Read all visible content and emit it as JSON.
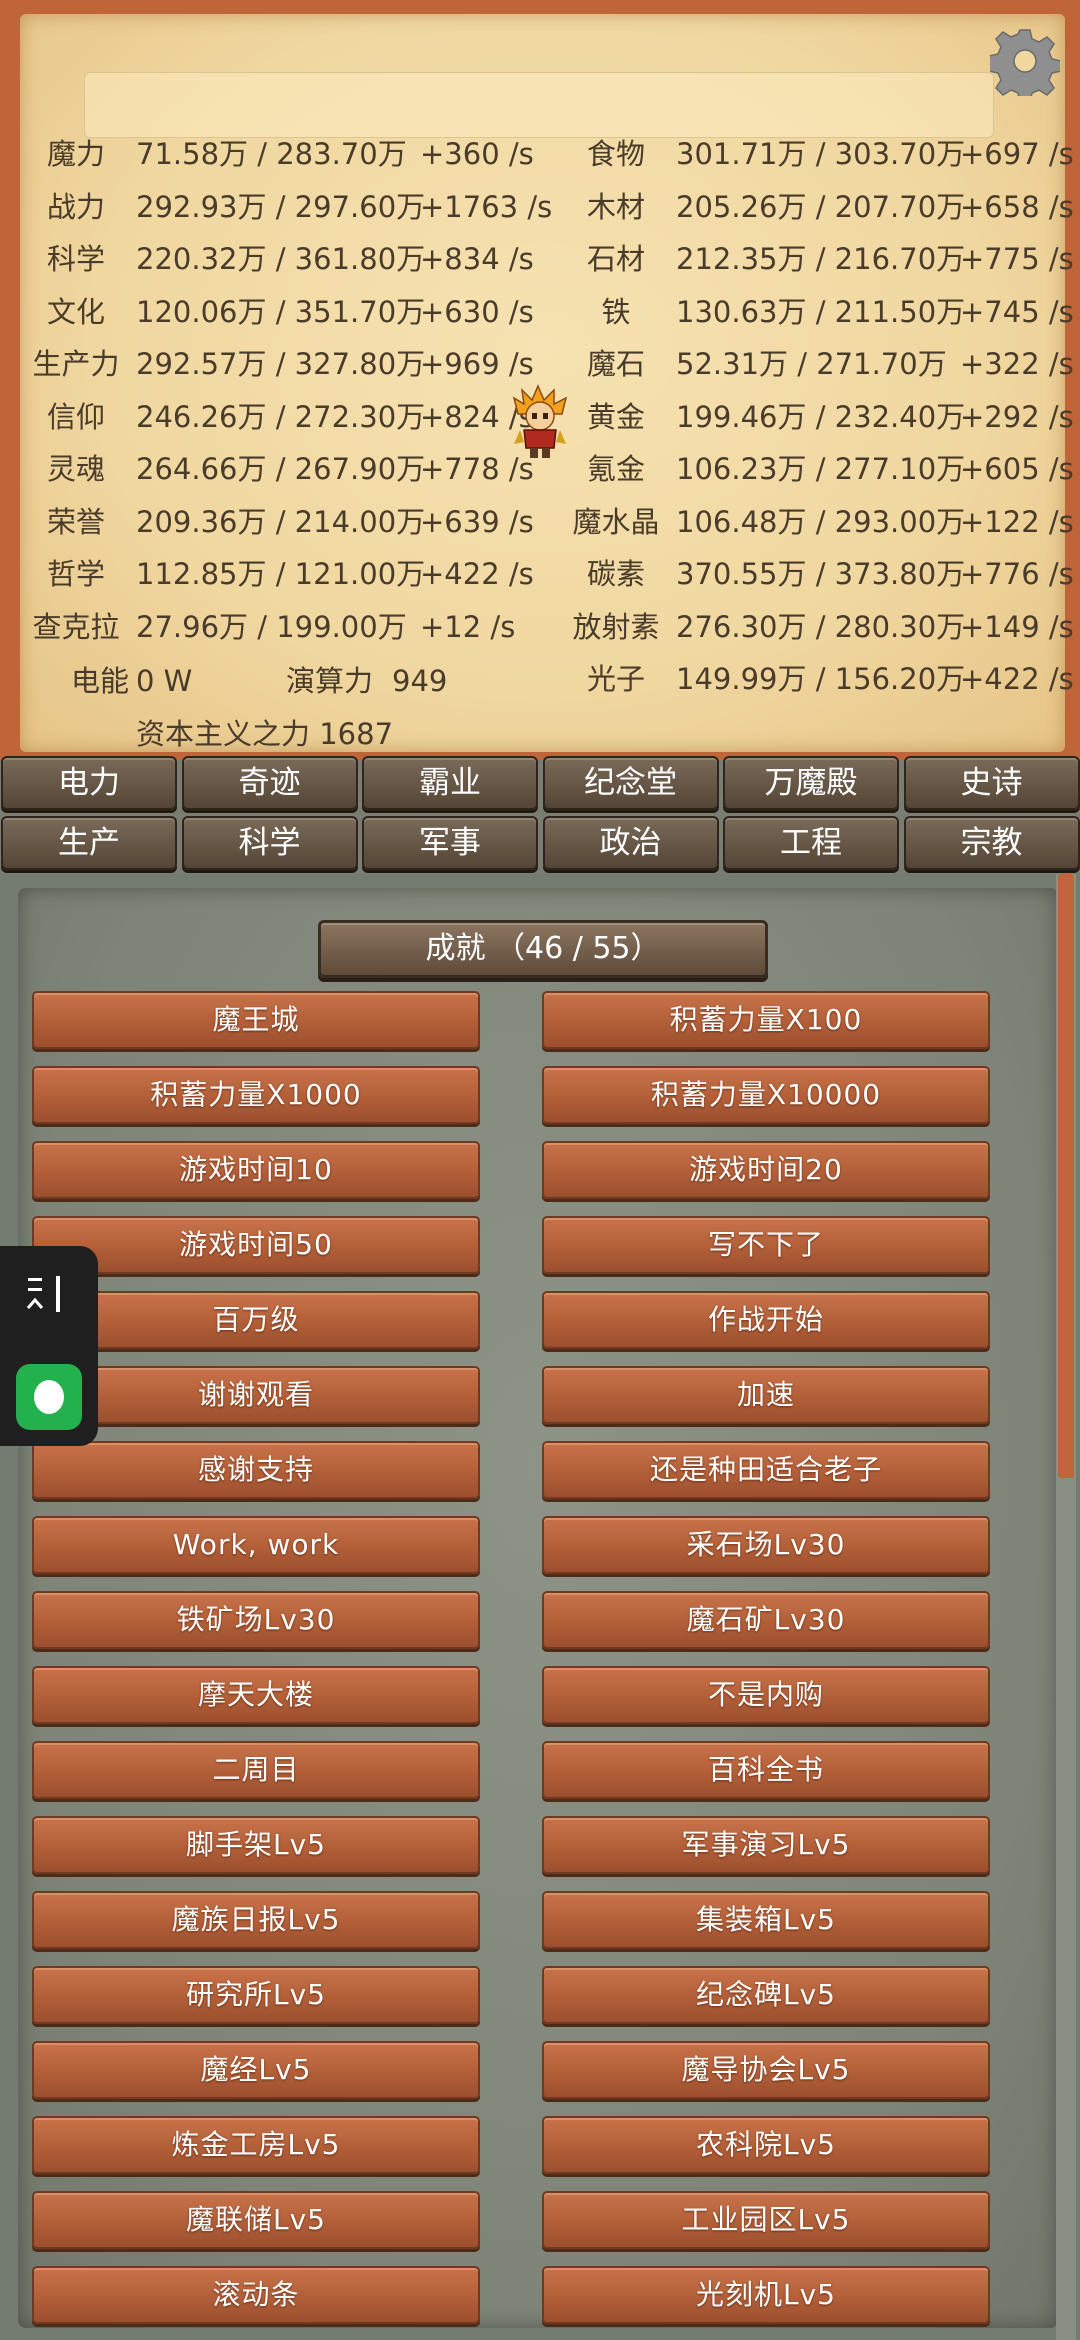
{
  "resources_left": [
    {
      "name": "魔力",
      "value": "71.58万 / 283.70万",
      "rate": "+360 /s"
    },
    {
      "name": "战力",
      "value": "292.93万 / 297.60万",
      "rate": "+1763 /s"
    },
    {
      "name": "科学",
      "value": "220.32万 / 361.80万",
      "rate": "+834 /s"
    },
    {
      "name": "文化",
      "value": "120.06万 / 351.70万",
      "rate": "+630 /s"
    },
    {
      "name": "生产力",
      "value": "292.57万 / 327.80万",
      "rate": "+969 /s"
    },
    {
      "name": "信仰",
      "value": "246.26万 / 272.30万",
      "rate": "+824 /s"
    },
    {
      "name": "灵魂",
      "value": "264.66万 / 267.90万",
      "rate": "+778 /s"
    },
    {
      "name": "荣誉",
      "value": "209.36万 / 214.00万",
      "rate": "+639 /s"
    },
    {
      "name": "哲学",
      "value": "112.85万 / 121.00万",
      "rate": "+422 /s"
    },
    {
      "name": "查克拉",
      "value": "27.96万 / 199.00万",
      "rate": "+12 /s"
    }
  ],
  "resources_right": [
    {
      "name": "食物",
      "value": "301.71万 / 303.70万",
      "rate": "+697 /s"
    },
    {
      "name": "木材",
      "value": "205.26万 / 207.70万",
      "rate": "+658 /s"
    },
    {
      "name": "石材",
      "value": "212.35万 / 216.70万",
      "rate": "+775 /s"
    },
    {
      "name": "铁",
      "value": "130.63万 / 211.50万",
      "rate": "+745 /s"
    },
    {
      "name": "魔石",
      "value": "52.31万 / 271.70万",
      "rate": "+322 /s"
    },
    {
      "name": "黄金",
      "value": "199.46万 / 232.40万",
      "rate": "+292 /s"
    },
    {
      "name": "氪金",
      "value": "106.23万 / 277.10万",
      "rate": "+605 /s"
    },
    {
      "name": "魔水晶",
      "value": "106.48万 / 293.00万",
      "rate": "+122 /s"
    },
    {
      "name": "碳素",
      "value": "370.55万 / 373.80万",
      "rate": "+776 /s"
    },
    {
      "name": "放射素",
      "value": "276.30万 / 280.30万",
      "rate": "+149 /s"
    },
    {
      "name": "光子",
      "value": "149.99万 / 156.20万",
      "rate": "+422 /s"
    }
  ],
  "power": {
    "name": "电能",
    "value": "0 W"
  },
  "compute": {
    "label": "演算力",
    "value": "949"
  },
  "capitalism": "资本主义之力 1687",
  "tabs_row1": [
    "电力",
    "奇迹",
    "霸业",
    "纪念堂",
    "万魔殿",
    "史诗"
  ],
  "tabs_row2": [
    "生产",
    "科学",
    "军事",
    "政治",
    "工程",
    "宗教"
  ],
  "achievements_title": "成就 （46 / 55）",
  "achievements": [
    "魔王城",
    "积蓄力量X100",
    "积蓄力量X1000",
    "积蓄力量X10000",
    "游戏时间10",
    "游戏时间20",
    "游戏时间50",
    "写不下了",
    "百万级",
    "作战开始",
    "谢谢观看",
    "加速",
    "感谢支持",
    "还是种田适合老子",
    "Work, work",
    "采石场Lv30",
    "铁矿场Lv30",
    "魔石矿Lv30",
    "摩天大楼",
    "不是内购",
    "二周目",
    "百科全书",
    "脚手架Lv5",
    "军事演习Lv5",
    "魔族日报Lv5",
    "集装箱Lv5",
    "研究所Lv5",
    "纪念碑Lv5",
    "魔经Lv5",
    "魔导协会Lv5",
    "炼金工房Lv5",
    "农科院Lv5",
    "魔联储Lv5",
    "工业园区Lv5",
    "滚动条",
    "光刻机Lv5"
  ],
  "colors": {
    "parchment": "#f0d7a0",
    "frame": "#c0653a",
    "wood_button": "#b25f38",
    "stone": "#7e8478",
    "float_green": "#22b14c"
  },
  "icons": {
    "settings": "gear-icon",
    "hero": "hero-sprite",
    "float_menu": "menu-icon",
    "float_chat": "chat-bubble-icon"
  }
}
